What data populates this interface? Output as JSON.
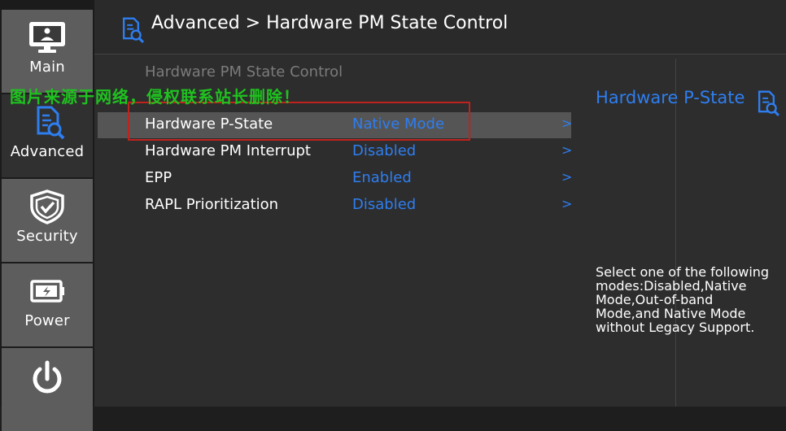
{
  "sidebar": {
    "tabs": [
      {
        "label": "Main",
        "icon": "monitor-icon"
      },
      {
        "label": "Advanced",
        "icon": "advanced-icon"
      },
      {
        "label": "Security",
        "icon": "shield-icon"
      },
      {
        "label": "Power",
        "icon": "battery-icon"
      },
      {
        "label": "",
        "icon": "power-icon"
      }
    ],
    "active": "Advanced"
  },
  "header": {
    "breadcrumb": "Advanced > Hardware PM State Control"
  },
  "main": {
    "section_title": "Hardware PM State Control",
    "rows": [
      {
        "label": "Hardware P-State",
        "value": "Native Mode",
        "arrow": ">"
      },
      {
        "label": "Hardware PM Interrupt",
        "value": "Disabled",
        "arrow": ">"
      },
      {
        "label": "EPP",
        "value": "Enabled",
        "arrow": ">"
      },
      {
        "label": "RAPL Prioritization",
        "value": "Disabled",
        "arrow": ">"
      }
    ],
    "selected_row": "Hardware P-State"
  },
  "help": {
    "title": "Hardware P-State",
    "text": "Select one of the following modes:Disabled,Native Mode,Out-of-band Mode,and Native Mode without Legacy Support."
  },
  "watermark": "图片来源于网络，侵权联系站长删除！",
  "colors": {
    "accent": "#2e7ef0",
    "highlight": "#c0221e",
    "watermark": "#1fc21f",
    "selected_row": "#555555"
  }
}
